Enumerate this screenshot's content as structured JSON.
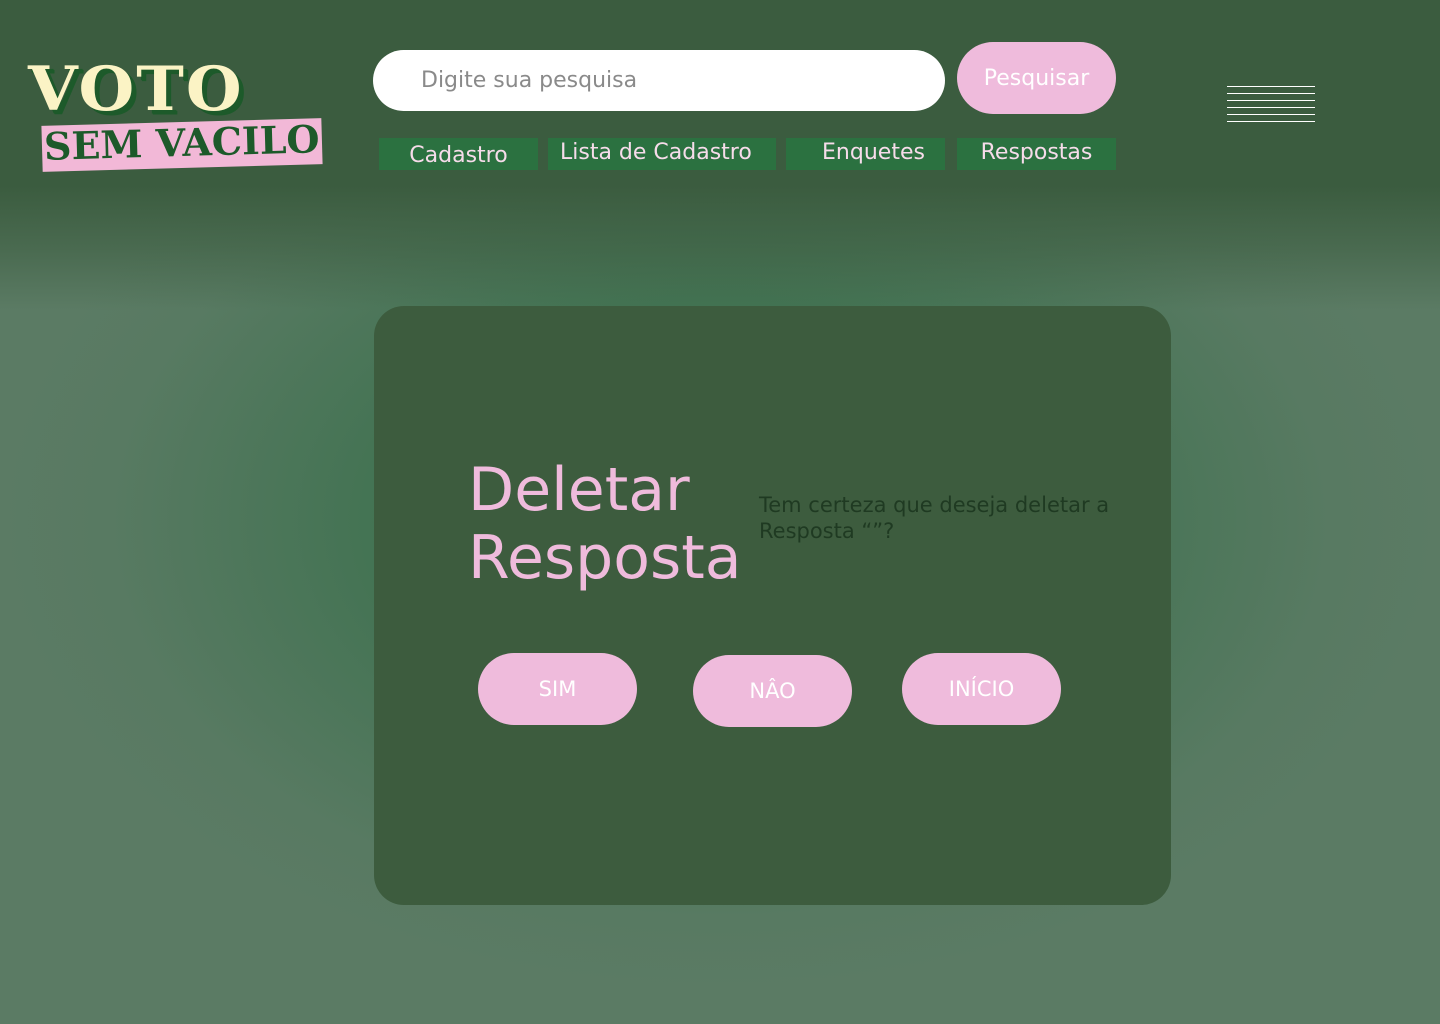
{
  "logo": {
    "line1": "VOTO",
    "line2": "SEM VACILO"
  },
  "search": {
    "placeholder": "Digite sua pesquisa",
    "button_label": "Pesquisar"
  },
  "menu": {
    "icon": "hamburger-menu-icon"
  },
  "nav": {
    "items": [
      {
        "label": "Cadastro"
      },
      {
        "label": "Lista de Cadastro"
      },
      {
        "label": "Enquetes"
      },
      {
        "label": "Respostas"
      }
    ]
  },
  "dialog": {
    "title": "Deletar Resposta",
    "message": "Tem certeza que deseja deletar a Resposta “”?",
    "buttons": {
      "yes": "SIM",
      "no": "NÂO",
      "home": "INÍCIO"
    }
  },
  "colors": {
    "header_bg": "#3b5c3f",
    "card_bg": "#3d5c3e",
    "accent_pink": "#efbbdc",
    "nav_bg": "#2b7140",
    "logo_cream": "#fbf3c5",
    "logo_green": "#1d5a2a"
  }
}
